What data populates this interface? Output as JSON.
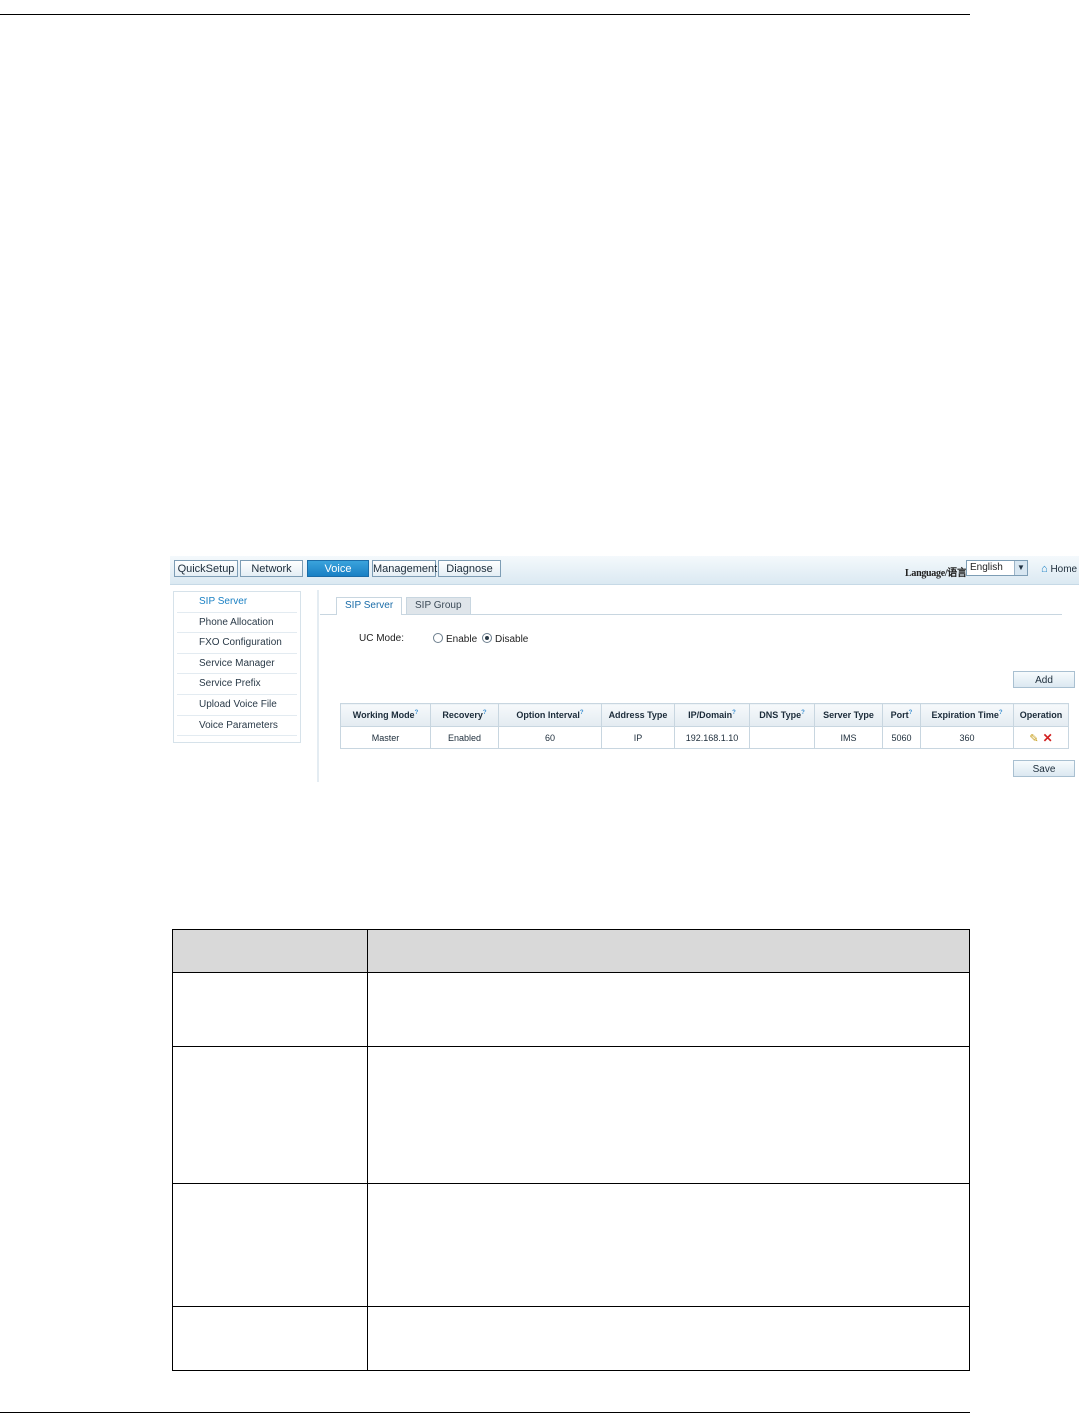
{
  "nav": {
    "quicksetup": "QuickSetup",
    "network": "Network",
    "voice": "Voice",
    "management": "Management",
    "diagnose": "Diagnose"
  },
  "language": {
    "label": "Language/语言:",
    "selected": "English"
  },
  "home_label": "Home",
  "sidebar": {
    "items": [
      {
        "label": "SIP Server"
      },
      {
        "label": "Phone Allocation"
      },
      {
        "label": "FXO Configuration"
      },
      {
        "label": "Service Manager"
      },
      {
        "label": "Service Prefix"
      },
      {
        "label": "Upload Voice File"
      },
      {
        "label": "Voice Parameters"
      }
    ]
  },
  "tabs": {
    "sip_server": "SIP Server",
    "sip_group": "SIP Group"
  },
  "uc_mode": {
    "label": "UC Mode:",
    "enable": "Enable",
    "disable": "Disable",
    "selected": "Disable"
  },
  "buttons": {
    "add": "Add",
    "save": "Save"
  },
  "sip_table": {
    "headers": [
      "Working Mode",
      "Recovery",
      "Option Interval",
      "Address Type",
      "IP/Domain",
      "DNS Type",
      "Server Type",
      "Port",
      "Expiration Time",
      "Operation"
    ],
    "rows": [
      [
        "Master",
        "Enabled",
        "60",
        "IP",
        "192.168.1.10",
        "",
        "IMS",
        "5060",
        "360",
        ""
      ]
    ]
  },
  "icons": {
    "edit": "edit-icon",
    "delete": "delete-icon",
    "home": "home-icon",
    "dropdown": "chevron-down-icon"
  },
  "colors": {
    "accent": "#1a80c4",
    "delete": "#d22020",
    "table_header": "#d9d9d9"
  }
}
